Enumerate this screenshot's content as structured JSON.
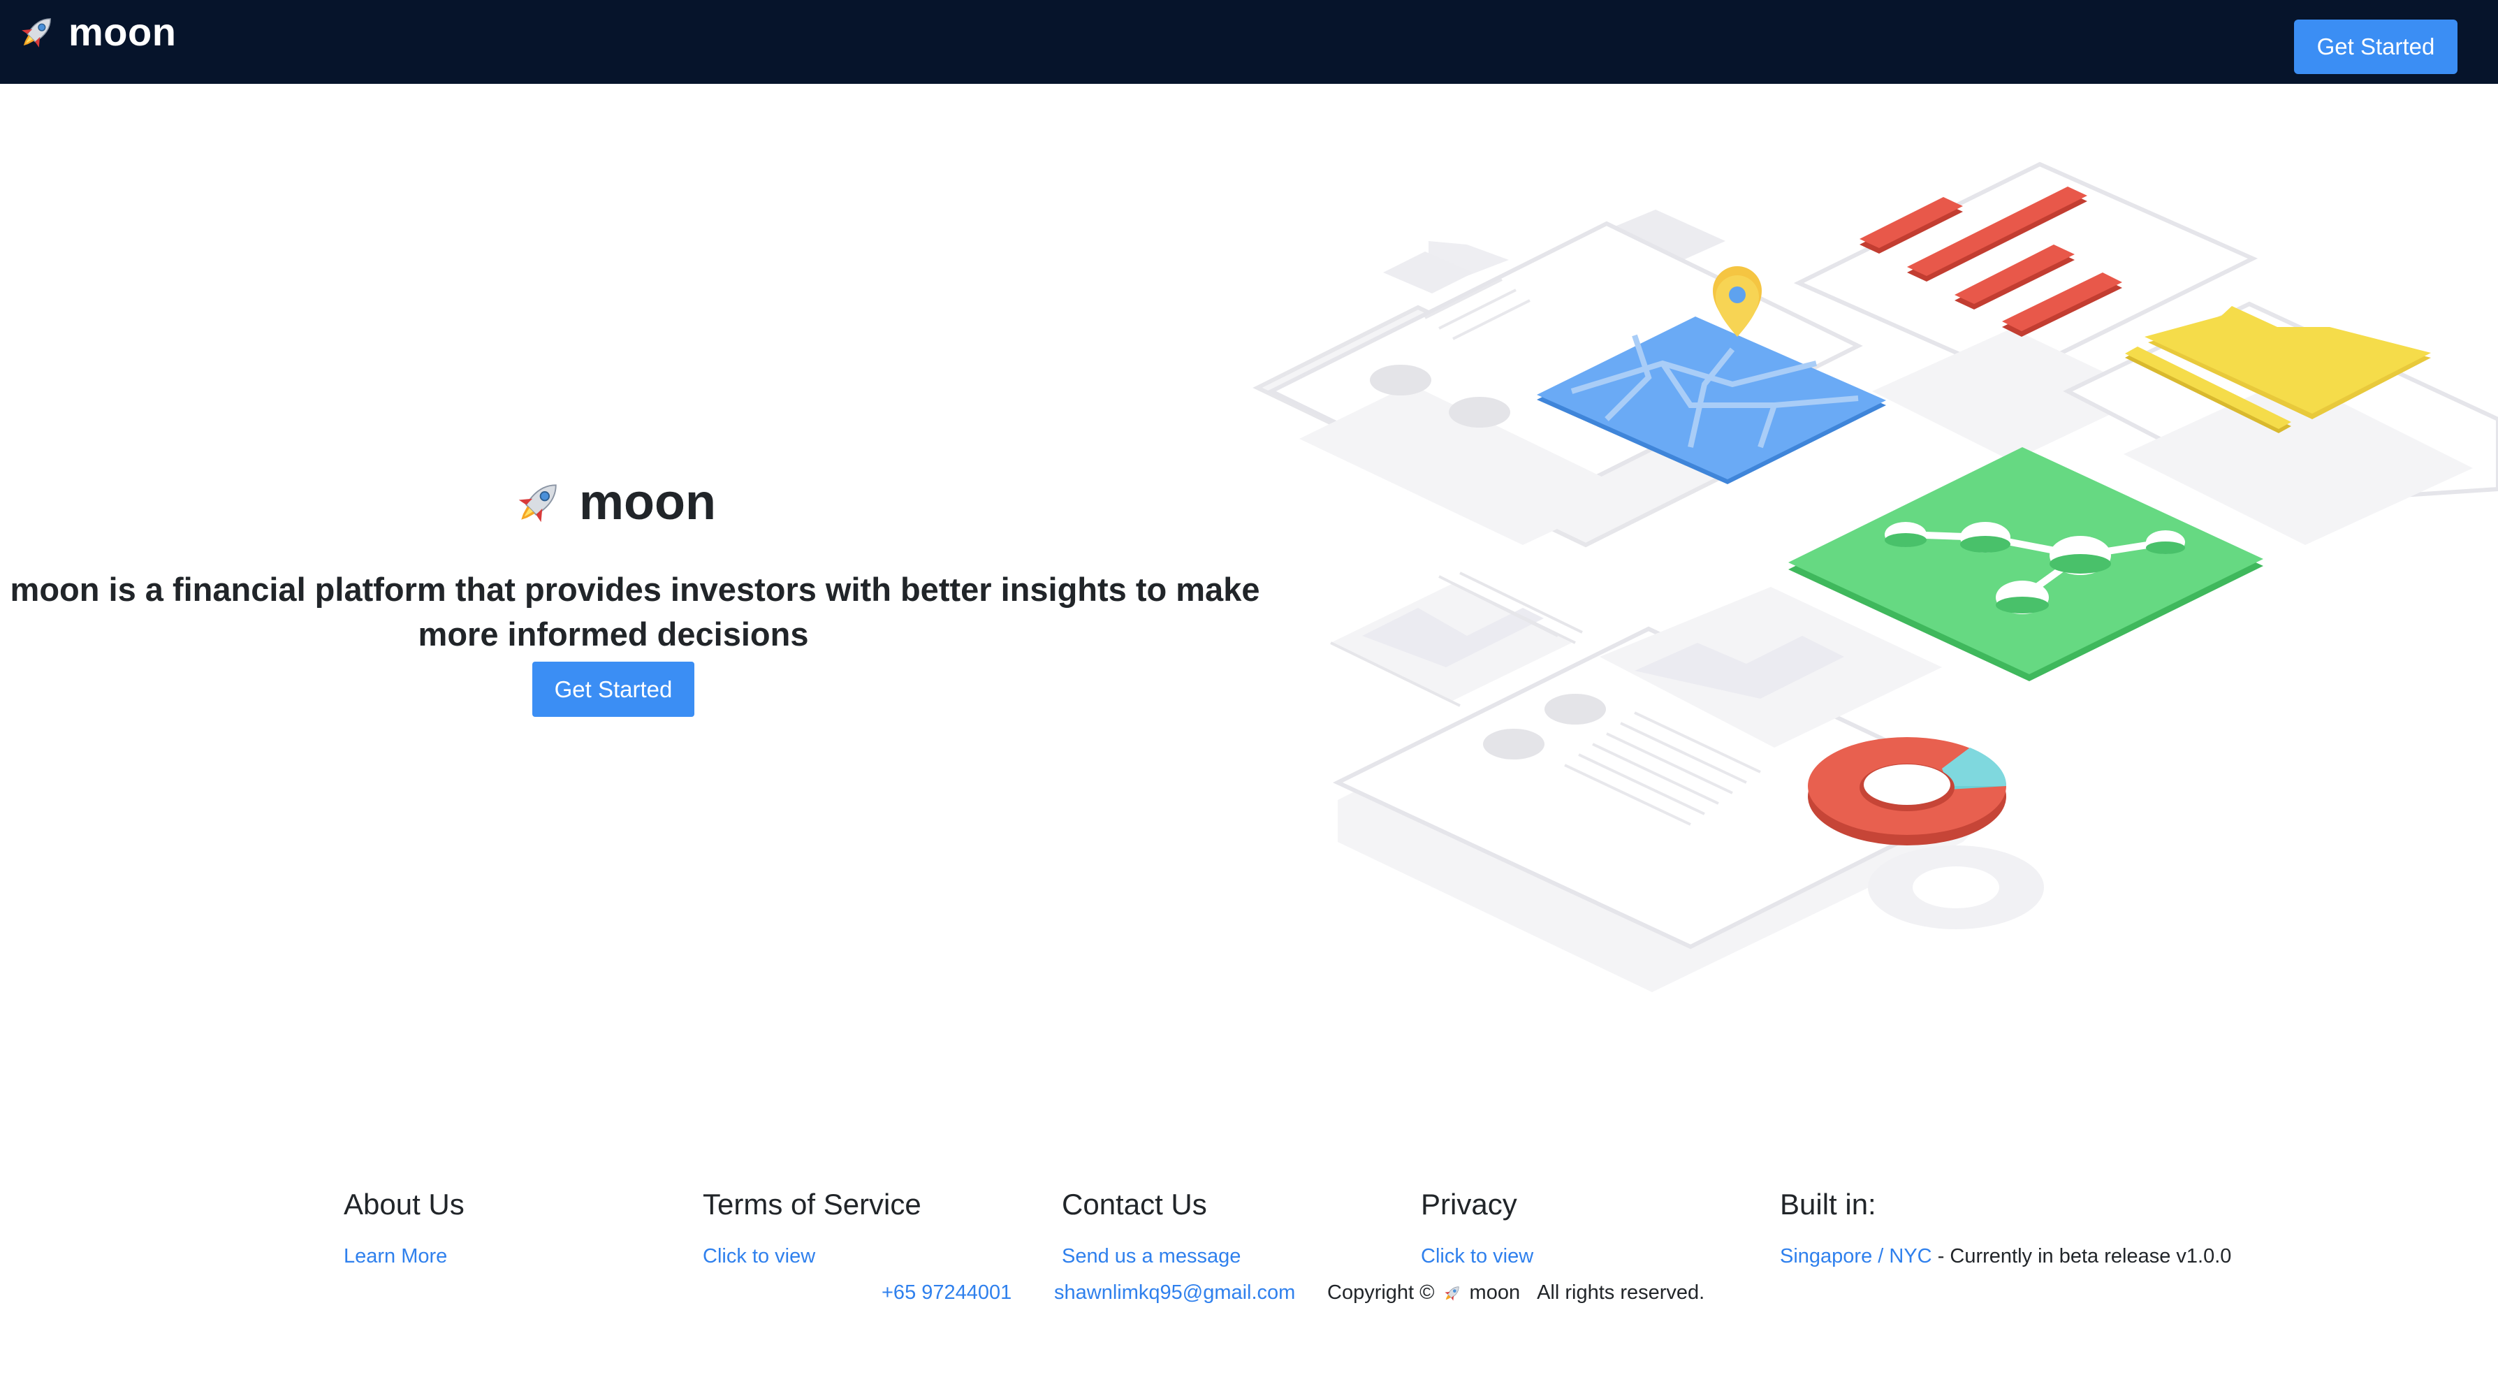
{
  "navbar": {
    "brand": "moon",
    "brand_icon": "rocket-icon",
    "cta_label": "Get Started",
    "background": "#06142b",
    "cta_color": "#3b8ef4"
  },
  "hero": {
    "title": "moon",
    "tagline_line1": "moon is a financial platform that provides investors with better insights to make",
    "tagline_line2": "more informed decisions",
    "cta_label": "Get Started"
  },
  "footer": {
    "about": {
      "heading": "About Us",
      "link": "Learn More"
    },
    "terms": {
      "heading": "Terms of Service",
      "link": "Click to view"
    },
    "contact": {
      "heading": "Contact Us",
      "link": "Send us a message",
      "phone": "+65 97244001",
      "email": "shawnlimkq95@gmail.com"
    },
    "privacy": {
      "heading": "Privacy",
      "link": "Click to view"
    },
    "built": {
      "heading": "Built in:",
      "location_link": "Singapore / NYC",
      "status": "- Currently in beta release v1.0.0"
    },
    "copyright": {
      "prefix": "Copyright ©",
      "brand": "moon",
      "rights": "All rights reserved."
    }
  },
  "colors": {
    "link": "#2f80ed",
    "map": "#6aaaf5",
    "bars": "#e8584a",
    "chart_yellow": "#f5dc4a",
    "network": "#66d982",
    "donut": "#e8604f",
    "donut_accent": "#7fd8de"
  }
}
